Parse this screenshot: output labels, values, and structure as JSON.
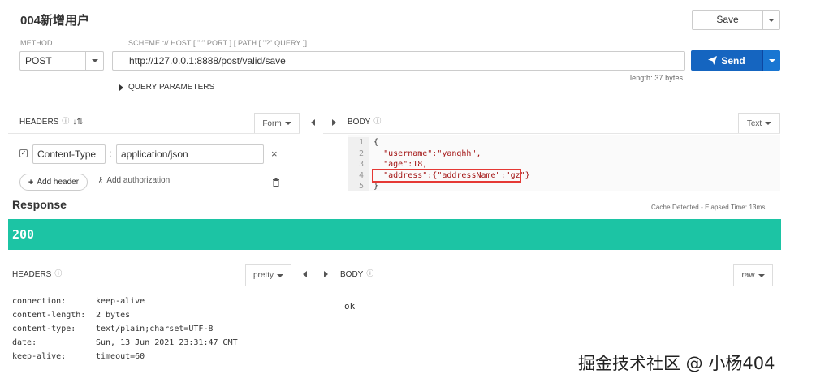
{
  "request": {
    "title": "004新增用户",
    "save_label": "Save",
    "method_label": "METHOD",
    "scheme_label": "SCHEME :// HOST [ \":\" PORT ] [ PATH [ \"?\" QUERY ]]",
    "method_value": "POST",
    "url_value": "http://127.0.0.1:8888/post/valid/save",
    "send_label": "Send",
    "length_text": "length: 37 bytes",
    "query_params_label": "QUERY PARAMETERS"
  },
  "req_headers": {
    "label": "HEADERS",
    "form_label": "Form",
    "header_key": "Content-Type",
    "header_value": "application/json",
    "add_header_label": "Add header",
    "add_auth_label": "Add authorization"
  },
  "req_body": {
    "label": "BODY",
    "format_label": "Text",
    "line_numbers": [
      "1",
      "2",
      "3",
      "4",
      "5"
    ],
    "lines": [
      "{",
      "  \"username\":\"yanghh\",",
      "  \"age\":18,",
      "  \"address\":{\"addressName\":\"gz\"}",
      "}"
    ]
  },
  "response": {
    "title": "Response",
    "cache_text": "Cache Detected - Elapsed Time: 13ms",
    "status_code": "200",
    "status_color": "#1cc4a4"
  },
  "resp_headers": {
    "label": "HEADERS",
    "pretty_label": "pretty",
    "rows": [
      {
        "key": "connection:",
        "value": "keep-alive"
      },
      {
        "key": "content-length:",
        "value": "2 bytes"
      },
      {
        "key": "content-type:",
        "value": "text/plain;charset=UTF-8"
      },
      {
        "key": "date:",
        "value": "Sun, 13 Jun 2021 23:31:47 GMT"
      },
      {
        "key": "keep-alive:",
        "value": "timeout=60"
      }
    ]
  },
  "resp_body": {
    "label": "BODY",
    "raw_label": "raw",
    "content": "ok"
  },
  "watermark": "掘金技术社区 @ 小杨404",
  "colors": {
    "accent": "#1565c0",
    "status": "#1cc4a4",
    "highlight_box": "#e53935"
  }
}
